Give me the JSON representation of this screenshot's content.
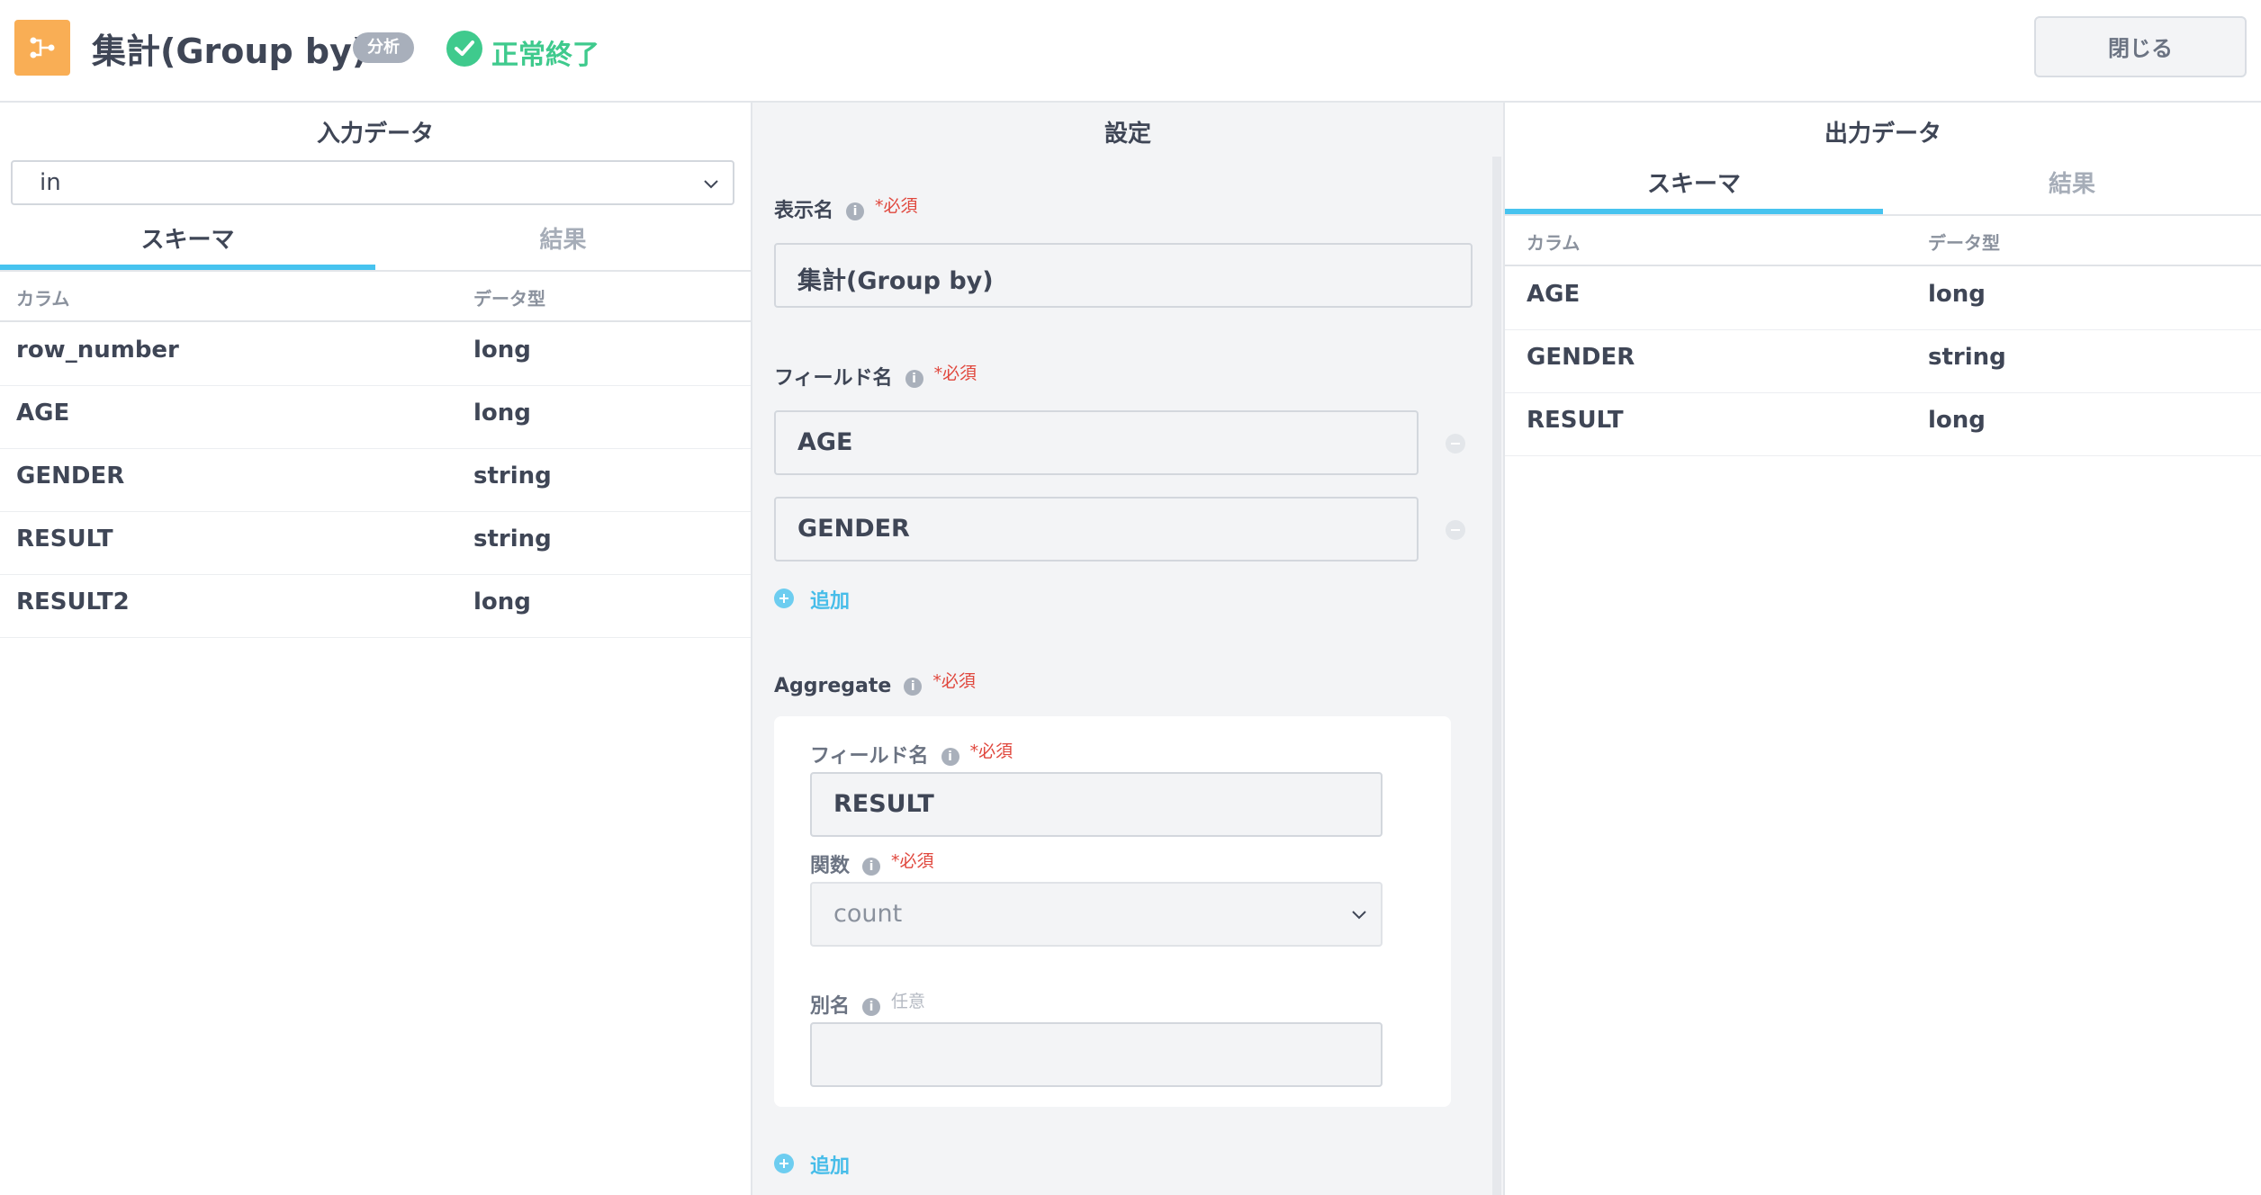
{
  "header": {
    "title": "集計(Group by)",
    "badge": "分析",
    "status": "正常終了",
    "close_label": "閉じる",
    "icon": "node-split-icon",
    "colors": {
      "icon_bg": "#f9ae55",
      "status": "#3fca8d",
      "accent": "#47c3ef"
    }
  },
  "input_panel": {
    "title": "入力データ",
    "selected_input": "in",
    "tabs": [
      {
        "label": "スキーマ",
        "active": true
      },
      {
        "label": "結果",
        "active": false
      }
    ],
    "columns": {
      "name": "カラム",
      "type": "データ型"
    },
    "rows": [
      {
        "name": "row_number",
        "type": "long"
      },
      {
        "name": "AGE",
        "type": "long"
      },
      {
        "name": "GENDER",
        "type": "string"
      },
      {
        "name": "RESULT",
        "type": "string"
      },
      {
        "name": "RESULT2",
        "type": "long"
      }
    ]
  },
  "settings_panel": {
    "title": "設定",
    "display_name": {
      "label": "表示名",
      "required": "*必須",
      "value": "集計(Group by)"
    },
    "field_names": {
      "label": "フィールド名",
      "required": "*必須",
      "values": [
        "AGE",
        "GENDER"
      ],
      "add_label": "追加"
    },
    "aggregate": {
      "label": "Aggregate",
      "required": "*必須",
      "field_name": {
        "label": "フィールド名",
        "required": "*必須",
        "value": "RESULT"
      },
      "function": {
        "label": "関数",
        "required": "*必須",
        "value": "count"
      },
      "alias": {
        "label": "別名",
        "optional": "任意",
        "value": ""
      },
      "add_label": "追加"
    }
  },
  "output_panel": {
    "title": "出力データ",
    "tabs": [
      {
        "label": "スキーマ",
        "active": true
      },
      {
        "label": "結果",
        "active": false
      }
    ],
    "columns": {
      "name": "カラム",
      "type": "データ型"
    },
    "rows": [
      {
        "name": "AGE",
        "type": "long"
      },
      {
        "name": "GENDER",
        "type": "string"
      },
      {
        "name": "RESULT",
        "type": "long"
      }
    ]
  }
}
